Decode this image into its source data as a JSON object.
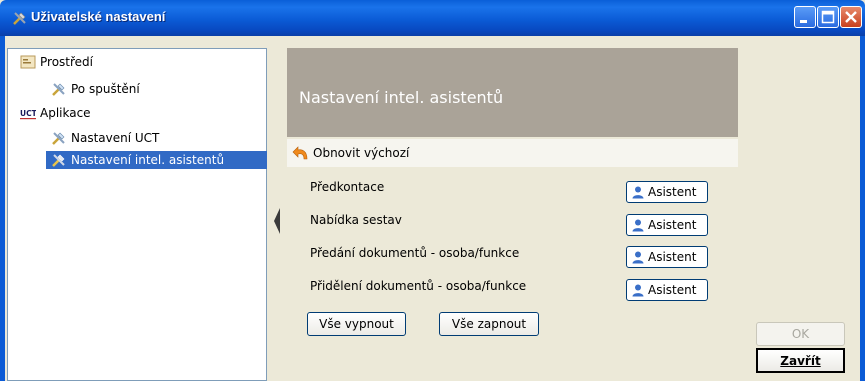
{
  "window": {
    "title": "Uživatelské nastavení",
    "icon": "tools-icon",
    "colors": {
      "titlebar": "#0b5bd6",
      "selection": "#316ac5",
      "header": "#aaa398"
    }
  },
  "tree": {
    "items": [
      {
        "label": "Prostředí",
        "icon": "environment-icon",
        "level": 0
      },
      {
        "label": "Po spuštění",
        "icon": "tools-icon",
        "level": 1
      },
      {
        "label": "Aplikace",
        "icon": "uct-logo-icon",
        "level": 0
      },
      {
        "label": "Nastavení UCT",
        "icon": "tools-icon",
        "level": 1
      },
      {
        "label": "Nastavení intel. asistentů",
        "icon": "tools-icon",
        "level": 1,
        "selected": true
      }
    ]
  },
  "content": {
    "title": "Nastavení intel. asistentů",
    "reset_label": "Obnovit výchozí",
    "settings": [
      {
        "label": "Předkontace",
        "button": "Asistent"
      },
      {
        "label": "Nabídka sestav",
        "button": "Asistent"
      },
      {
        "label": "Předání dokumentů - osoba/funkce",
        "button": "Asistent"
      },
      {
        "label": "Přidělení dokumentů - osoba/funkce",
        "button": "Asistent"
      }
    ],
    "disable_all": "Vše vypnout",
    "enable_all": "Vše zapnout"
  },
  "actions": {
    "ok": "OK",
    "close": "Zavřít"
  }
}
